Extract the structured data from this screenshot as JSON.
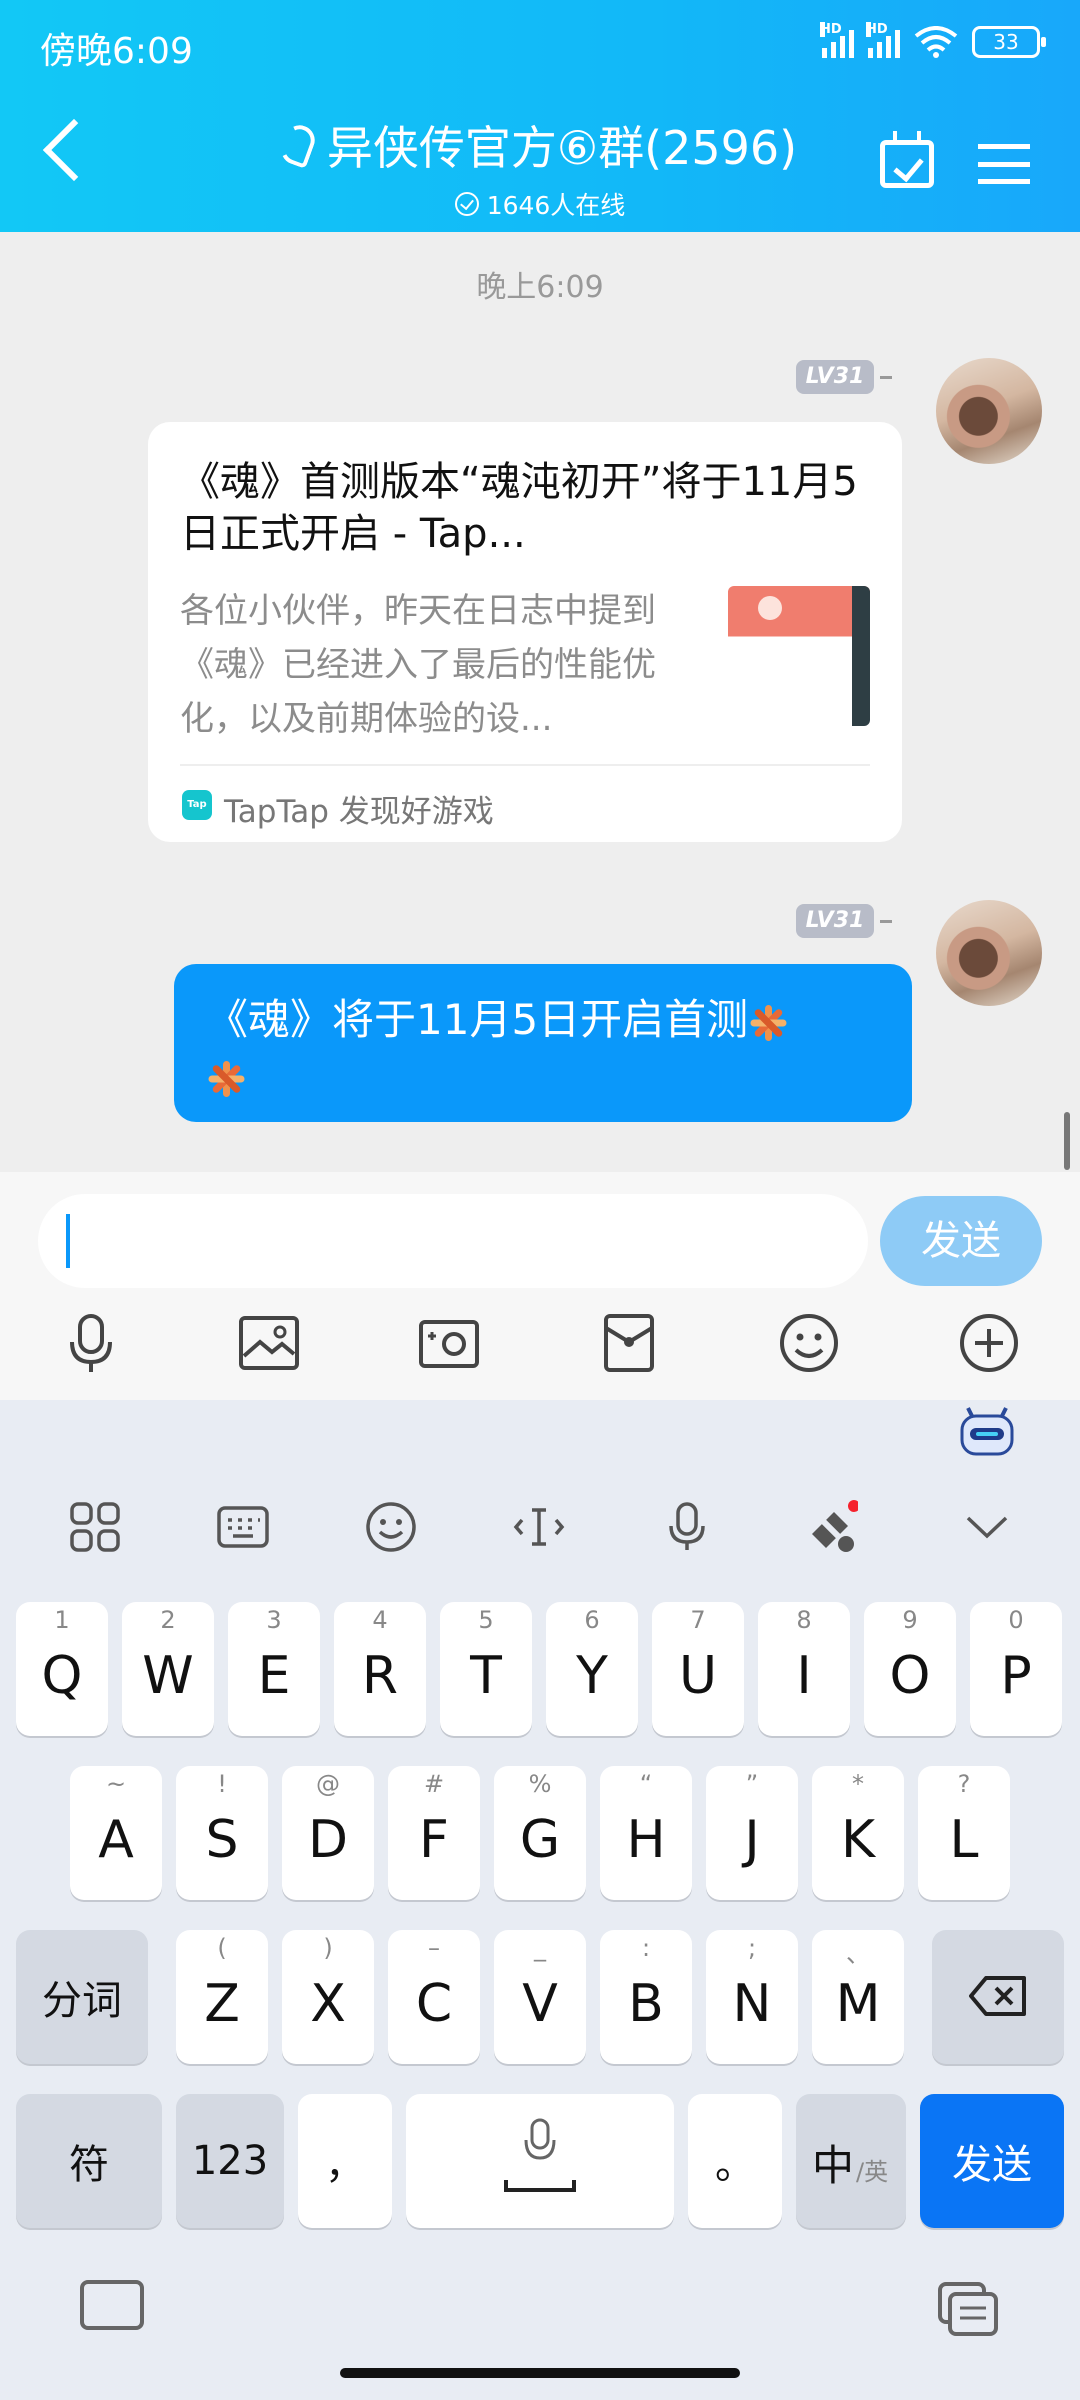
{
  "status_bar": {
    "time": "傍晚6:09",
    "signal_1": "HD",
    "signal_2": "HD",
    "battery": "33"
  },
  "header": {
    "title": "异侠传官方⑥群(2596)",
    "online": "1646人在线"
  },
  "chat": {
    "timestamp": "晚上6:09",
    "messages": [
      {
        "type": "link_card",
        "level": "LV31",
        "title": "《魂》首测版本“魂沌初开”将于11月5日正式开启 - Tap...",
        "description": "各位小伙伴，昨天在日志中提到《魂》已经进入了最后的性能优化，以及前期体验的设...",
        "source": "TapTap 发现好游戏",
        "source_icon_label": "Tap"
      },
      {
        "type": "text",
        "level": "LV31",
        "text": "《魂》将于11月5日开启首测"
      }
    ]
  },
  "input_bar": {
    "placeholder": "",
    "send_label": "发送"
  },
  "keyboard": {
    "row1": [
      {
        "sub": "1",
        "main": "Q"
      },
      {
        "sub": "2",
        "main": "W"
      },
      {
        "sub": "3",
        "main": "E"
      },
      {
        "sub": "4",
        "main": "R"
      },
      {
        "sub": "5",
        "main": "T"
      },
      {
        "sub": "6",
        "main": "Y"
      },
      {
        "sub": "7",
        "main": "U"
      },
      {
        "sub": "8",
        "main": "I"
      },
      {
        "sub": "9",
        "main": "O"
      },
      {
        "sub": "0",
        "main": "P"
      }
    ],
    "row2": [
      {
        "sub": "~",
        "main": "A"
      },
      {
        "sub": "!",
        "main": "S"
      },
      {
        "sub": "@",
        "main": "D"
      },
      {
        "sub": "#",
        "main": "F"
      },
      {
        "sub": "%",
        "main": "G"
      },
      {
        "sub": "“",
        "main": "H"
      },
      {
        "sub": "”",
        "main": "J"
      },
      {
        "sub": "*",
        "main": "K"
      },
      {
        "sub": "?",
        "main": "L"
      }
    ],
    "row3": [
      {
        "sub": "(",
        "main": "Z"
      },
      {
        "sub": ")",
        "main": "X"
      },
      {
        "sub": "–",
        "main": "C"
      },
      {
        "sub": "_",
        "main": "V"
      },
      {
        "sub": ":",
        "main": "B"
      },
      {
        "sub": ";",
        "main": "N"
      },
      {
        "sub": "、",
        "main": "M"
      }
    ],
    "segment_label": "分词",
    "symbol_label": "符",
    "number_label": "123",
    "comma_label": "，",
    "period_label": "。",
    "lang_main": "中",
    "lang_sub": "/英",
    "send_label": "发送"
  },
  "colors": {
    "header": "#12b8f8",
    "bubble": "#0a98fa",
    "send_key": "#0a75f5",
    "send_disabled": "#8ecbf6"
  }
}
